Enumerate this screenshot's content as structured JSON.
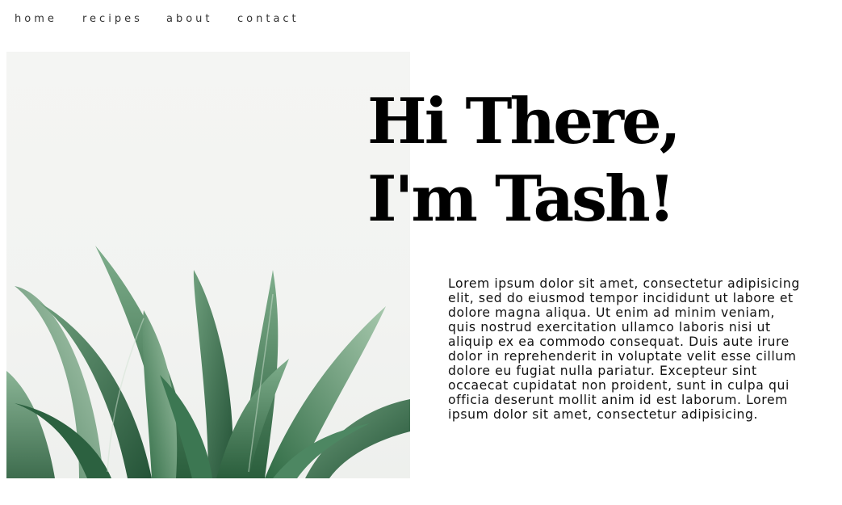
{
  "nav": {
    "items": [
      {
        "label": "home"
      },
      {
        "label": "recipes"
      },
      {
        "label": "about"
      },
      {
        "label": "contact"
      }
    ]
  },
  "hero": {
    "heading_line1": "Hi There,",
    "heading_line2": "I'm Tash!",
    "bio": "Lorem ipsum dolor sit amet, consectetur adipisicing elit, sed do eiusmod tempor incididunt ut labore et dolore magna aliqua. Ut enim ad minim veniam, quis nostrud exercitation ullamco laboris nisi ut aliquip ex ea commodo consequat. Duis aute irure dolor in reprehenderit in voluptate velit esse cillum dolore eu fugiat nulla pariatur. Excepteur sint occaecat cupidatat non proident, sunt in culpa qui officia deserunt mollit anim id est laborum.  Lorem ipsum dolor sit amet, consectetur adipisicing."
  },
  "colors": {
    "background": "#ffffff",
    "text": "#111111",
    "leaf_dark": "#2f6b44",
    "leaf_light": "#8fb79a"
  }
}
